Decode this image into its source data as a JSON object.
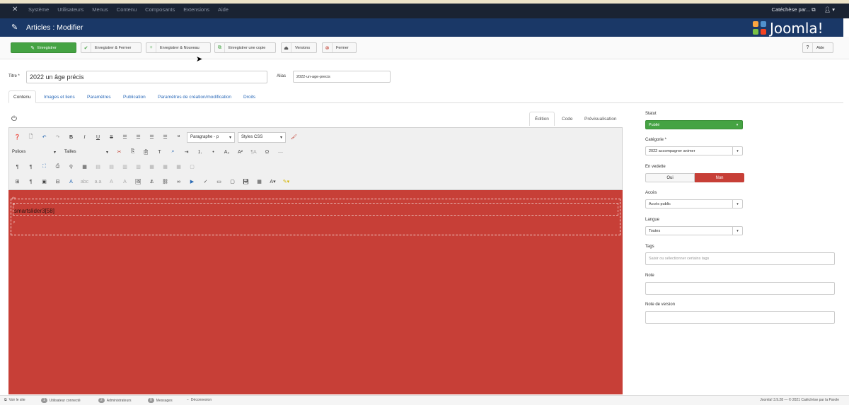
{
  "topbar": {
    "menu": [
      "Système",
      "Utilisateurs",
      "Menus",
      "Contenu",
      "Composants",
      "Extensions",
      "Aide"
    ],
    "site_name": "Catéchèse par...",
    "user_icon": "user-icon"
  },
  "header": {
    "title": "Articles : Modifier",
    "logo_text": "Joomla!"
  },
  "toolbar": {
    "save": "Enregistrer",
    "save_close": "Enregistrer & Fermer",
    "save_new": "Enregistrer & Nouveau",
    "save_copy": "Enregistrer une copie",
    "versions": "Versions",
    "close": "Fermer",
    "help": "Aide"
  },
  "form": {
    "title_label": "Titre *",
    "title_value": "2022 un âge précis",
    "alias_label": "Alias",
    "alias_value": "2022-un-age-precis"
  },
  "tabs": [
    "Contenu",
    "Images et liens",
    "Paramètres",
    "Publication",
    "Paramètres de création/modification",
    "Droits"
  ],
  "editor": {
    "mode_tabs": [
      "Édition",
      "Code",
      "Prévisualisation"
    ],
    "format_select": "Paragraphe - p",
    "styles_select": "Styles CSS",
    "font_select": "Polices",
    "size_select": "Tailles",
    "content_text": "smartslider3[58]",
    "marker_div": "div",
    "marker_p": "p"
  },
  "sidebar": {
    "status_label": "Statut",
    "status_value": "Publié",
    "category_label": "Catégorie *",
    "category_value": "2022 accompagner animer",
    "featured_label": "En vedette",
    "featured_yes": "Oui",
    "featured_no": "Non",
    "access_label": "Accès",
    "access_value": "Accès public",
    "language_label": "Langue",
    "language_value": "Toutes",
    "tags_label": "Tags",
    "tags_placeholder": "Saisir ou sélectionner certains tags",
    "note_label": "Note",
    "version_note_label": "Note de version"
  },
  "footer": {
    "view_site": "Voir le site",
    "users_count": "1",
    "users_label": "Utilisateur connecté",
    "admins_count": "2",
    "admins_label": "Administrateurs",
    "messages_count": "0",
    "messages_label": "Messages",
    "logout": "Déconnexion",
    "version_info": "Joomla! 3.9.28 — © 2021 Catéchèse par la Parole"
  },
  "colors": {
    "header_bg": "#1a3867",
    "save_green": "#45a343",
    "status_green": "#45a343",
    "no_red": "#c73f37",
    "content_red": "#c73f37"
  }
}
